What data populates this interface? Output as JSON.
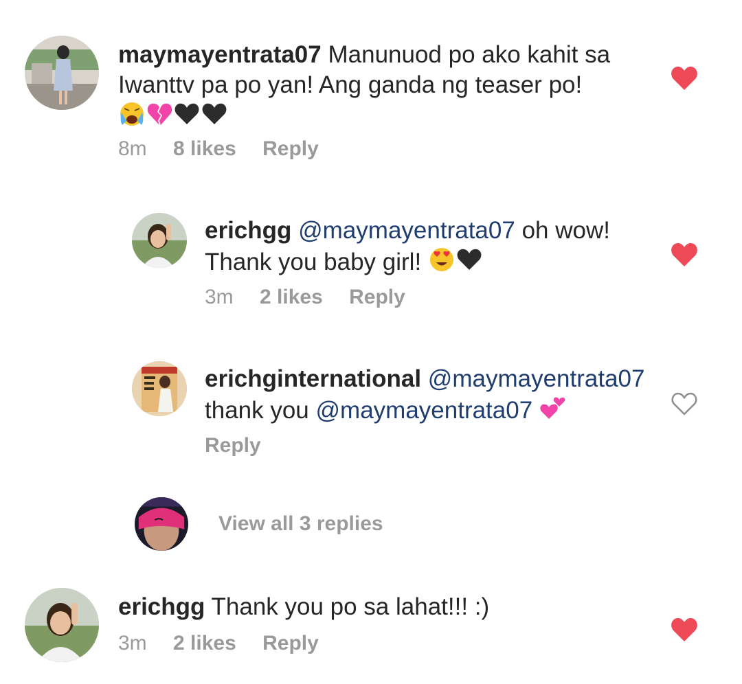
{
  "comments": [
    {
      "username": "maymayentrata07",
      "text_line1": "Manunuod po ako kahit sa",
      "text_line2": "Iwanttv pa po yan! Ang ganda ng teaser po!",
      "emojis": [
        "crying-face-emoji",
        "broken-heart-emoji",
        "black-heart-emoji",
        "black-heart-emoji"
      ],
      "time": "8m",
      "likes": "8 likes",
      "reply": "Reply",
      "liked": true
    },
    {
      "username": "erichgg",
      "mention": "@maymayentrata07",
      "text_after": "oh wow!",
      "text_line2": "Thank you baby girl!",
      "emojis": [
        "heart-eyes-emoji",
        "black-heart-emoji"
      ],
      "time": "3m",
      "likes": "2 likes",
      "reply": "Reply",
      "liked": true
    },
    {
      "username": "erichginternational",
      "mention": "@maymayentrata07",
      "text_line2": "thank you",
      "mention2": "@maymayentrata07",
      "emojis": [
        "two-hearts-emoji"
      ],
      "reply": "Reply",
      "liked": false
    },
    {
      "view_all": "View all 3 replies"
    },
    {
      "username": "erichgg",
      "text": "Thank you po sa lahat!!! :)",
      "time": "3m",
      "likes": "2 likes",
      "reply": "Reply",
      "liked": true
    }
  ],
  "colors": {
    "heart_red": "#ed4956",
    "meta_gray": "#9a9a9a",
    "mention_blue": "#1f3d6e"
  }
}
